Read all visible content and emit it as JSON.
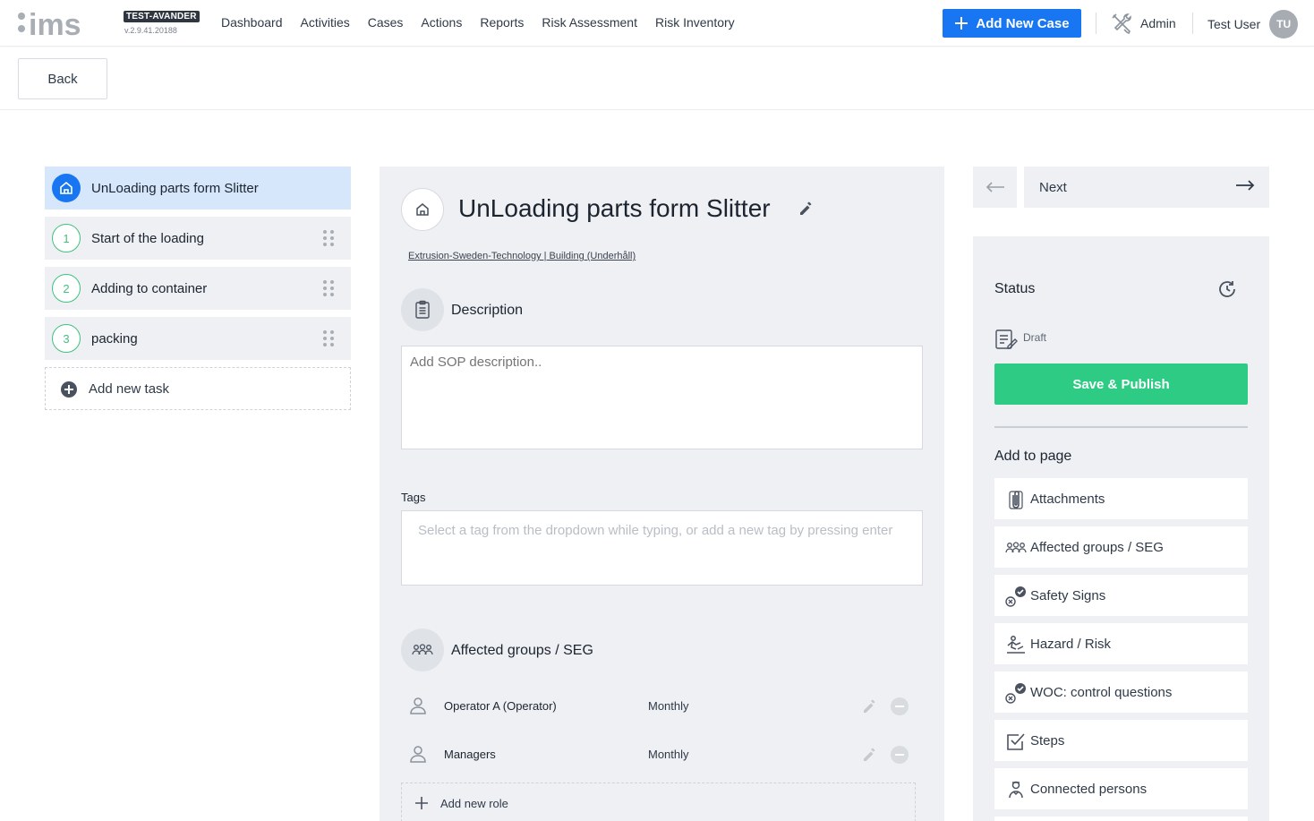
{
  "header": {
    "logo_text": "ims",
    "env_badge": "TEST-AVANDER",
    "version": "v.2.9.41.20188",
    "nav": [
      "Dashboard",
      "Activities",
      "Cases",
      "Actions",
      "Reports",
      "Risk Assessment",
      "Risk Inventory"
    ],
    "add_case_label": "Add New Case",
    "admin_label": "Admin",
    "user_name": "Test User",
    "user_initials": "TU",
    "accent_color": "#1876f2"
  },
  "subbar": {
    "back_label": "Back"
  },
  "tasks": {
    "active": {
      "label": "UnLoading parts form Slitter",
      "icon": "home-icon"
    },
    "items": [
      {
        "number": "1",
        "label": "Start of the loading"
      },
      {
        "number": "2",
        "label": "Adding to container"
      },
      {
        "number": "3",
        "label": "packing"
      }
    ],
    "add_label": "Add new task"
  },
  "main": {
    "title": "UnLoading parts form Slitter",
    "breadcrumb": "Extrusion-Sweden-Technology | Building (Underhåll)",
    "description": {
      "heading": "Description",
      "placeholder": "Add SOP description.."
    },
    "tags": {
      "label": "Tags",
      "placeholder": "Select a tag from the dropdown while typing, or add a new tag by pressing enter"
    },
    "affected_groups": {
      "heading": "Affected groups / SEG",
      "roles": [
        {
          "name": "Operator A (Operator)",
          "frequency": "Monthly"
        },
        {
          "name": "Managers",
          "frequency": "Monthly"
        }
      ],
      "add_label": "Add new role"
    }
  },
  "pager": {
    "next_label": "Next"
  },
  "sidebar": {
    "status_title": "Status",
    "status_value": "Draft",
    "publish_label": "Save & Publish",
    "publish_color": "#2dcb83",
    "add_to_page_title": "Add to page",
    "items": [
      {
        "label": "Attachments",
        "icon": "paperclip-icon"
      },
      {
        "label": "Affected groups / SEG",
        "icon": "group-icon"
      },
      {
        "label": "Safety Signs",
        "icon": "check-badge-icon"
      },
      {
        "label": "Hazard / Risk",
        "icon": "hazard-icon"
      },
      {
        "label": "WOC: control questions",
        "icon": "check-badge-icon"
      },
      {
        "label": "Steps",
        "icon": "checkbox-icon"
      },
      {
        "label": "Connected persons",
        "icon": "person-badge-icon"
      }
    ]
  }
}
